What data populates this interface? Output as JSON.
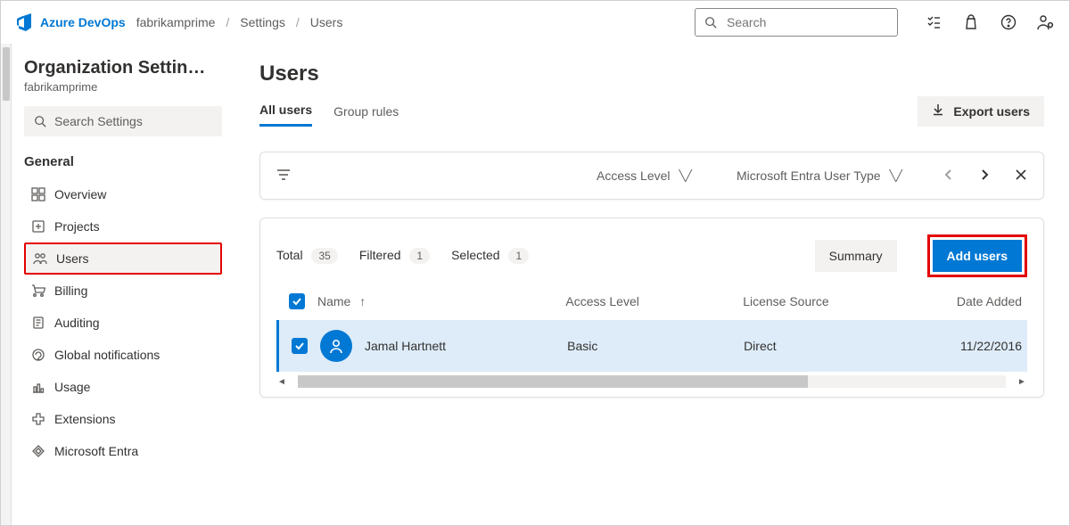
{
  "header": {
    "brand": "Azure DevOps",
    "org": "fabrikamprime",
    "crumbs": [
      "Settings",
      "Users"
    ],
    "search_placeholder": "Search"
  },
  "sidebar": {
    "title": "Organization Settin…",
    "subtitle": "fabrikamprime",
    "search_placeholder": "Search Settings",
    "group_title": "General",
    "items": [
      {
        "label": "Overview"
      },
      {
        "label": "Projects"
      },
      {
        "label": "Users"
      },
      {
        "label": "Billing"
      },
      {
        "label": "Auditing"
      },
      {
        "label": "Global notifications"
      },
      {
        "label": "Usage"
      },
      {
        "label": "Extensions"
      },
      {
        "label": "Microsoft Entra"
      }
    ]
  },
  "main": {
    "title": "Users",
    "tabs": {
      "all_users": "All users",
      "group_rules": "Group rules"
    },
    "export_label": "Export users",
    "filters": {
      "access_level": "Access Level",
      "entra_type": "Microsoft Entra User Type"
    },
    "stats": {
      "total_label": "Total",
      "total_count": "35",
      "filtered_label": "Filtered",
      "filtered_count": "1",
      "selected_label": "Selected",
      "selected_count": "1"
    },
    "summary_label": "Summary",
    "add_users_label": "Add users",
    "columns": {
      "name": "Name",
      "access": "Access Level",
      "source": "License Source",
      "date": "Date Added"
    },
    "rows": [
      {
        "name": "Jamal Hartnett",
        "access": "Basic",
        "source": "Direct",
        "date": "11/22/2016"
      }
    ]
  }
}
